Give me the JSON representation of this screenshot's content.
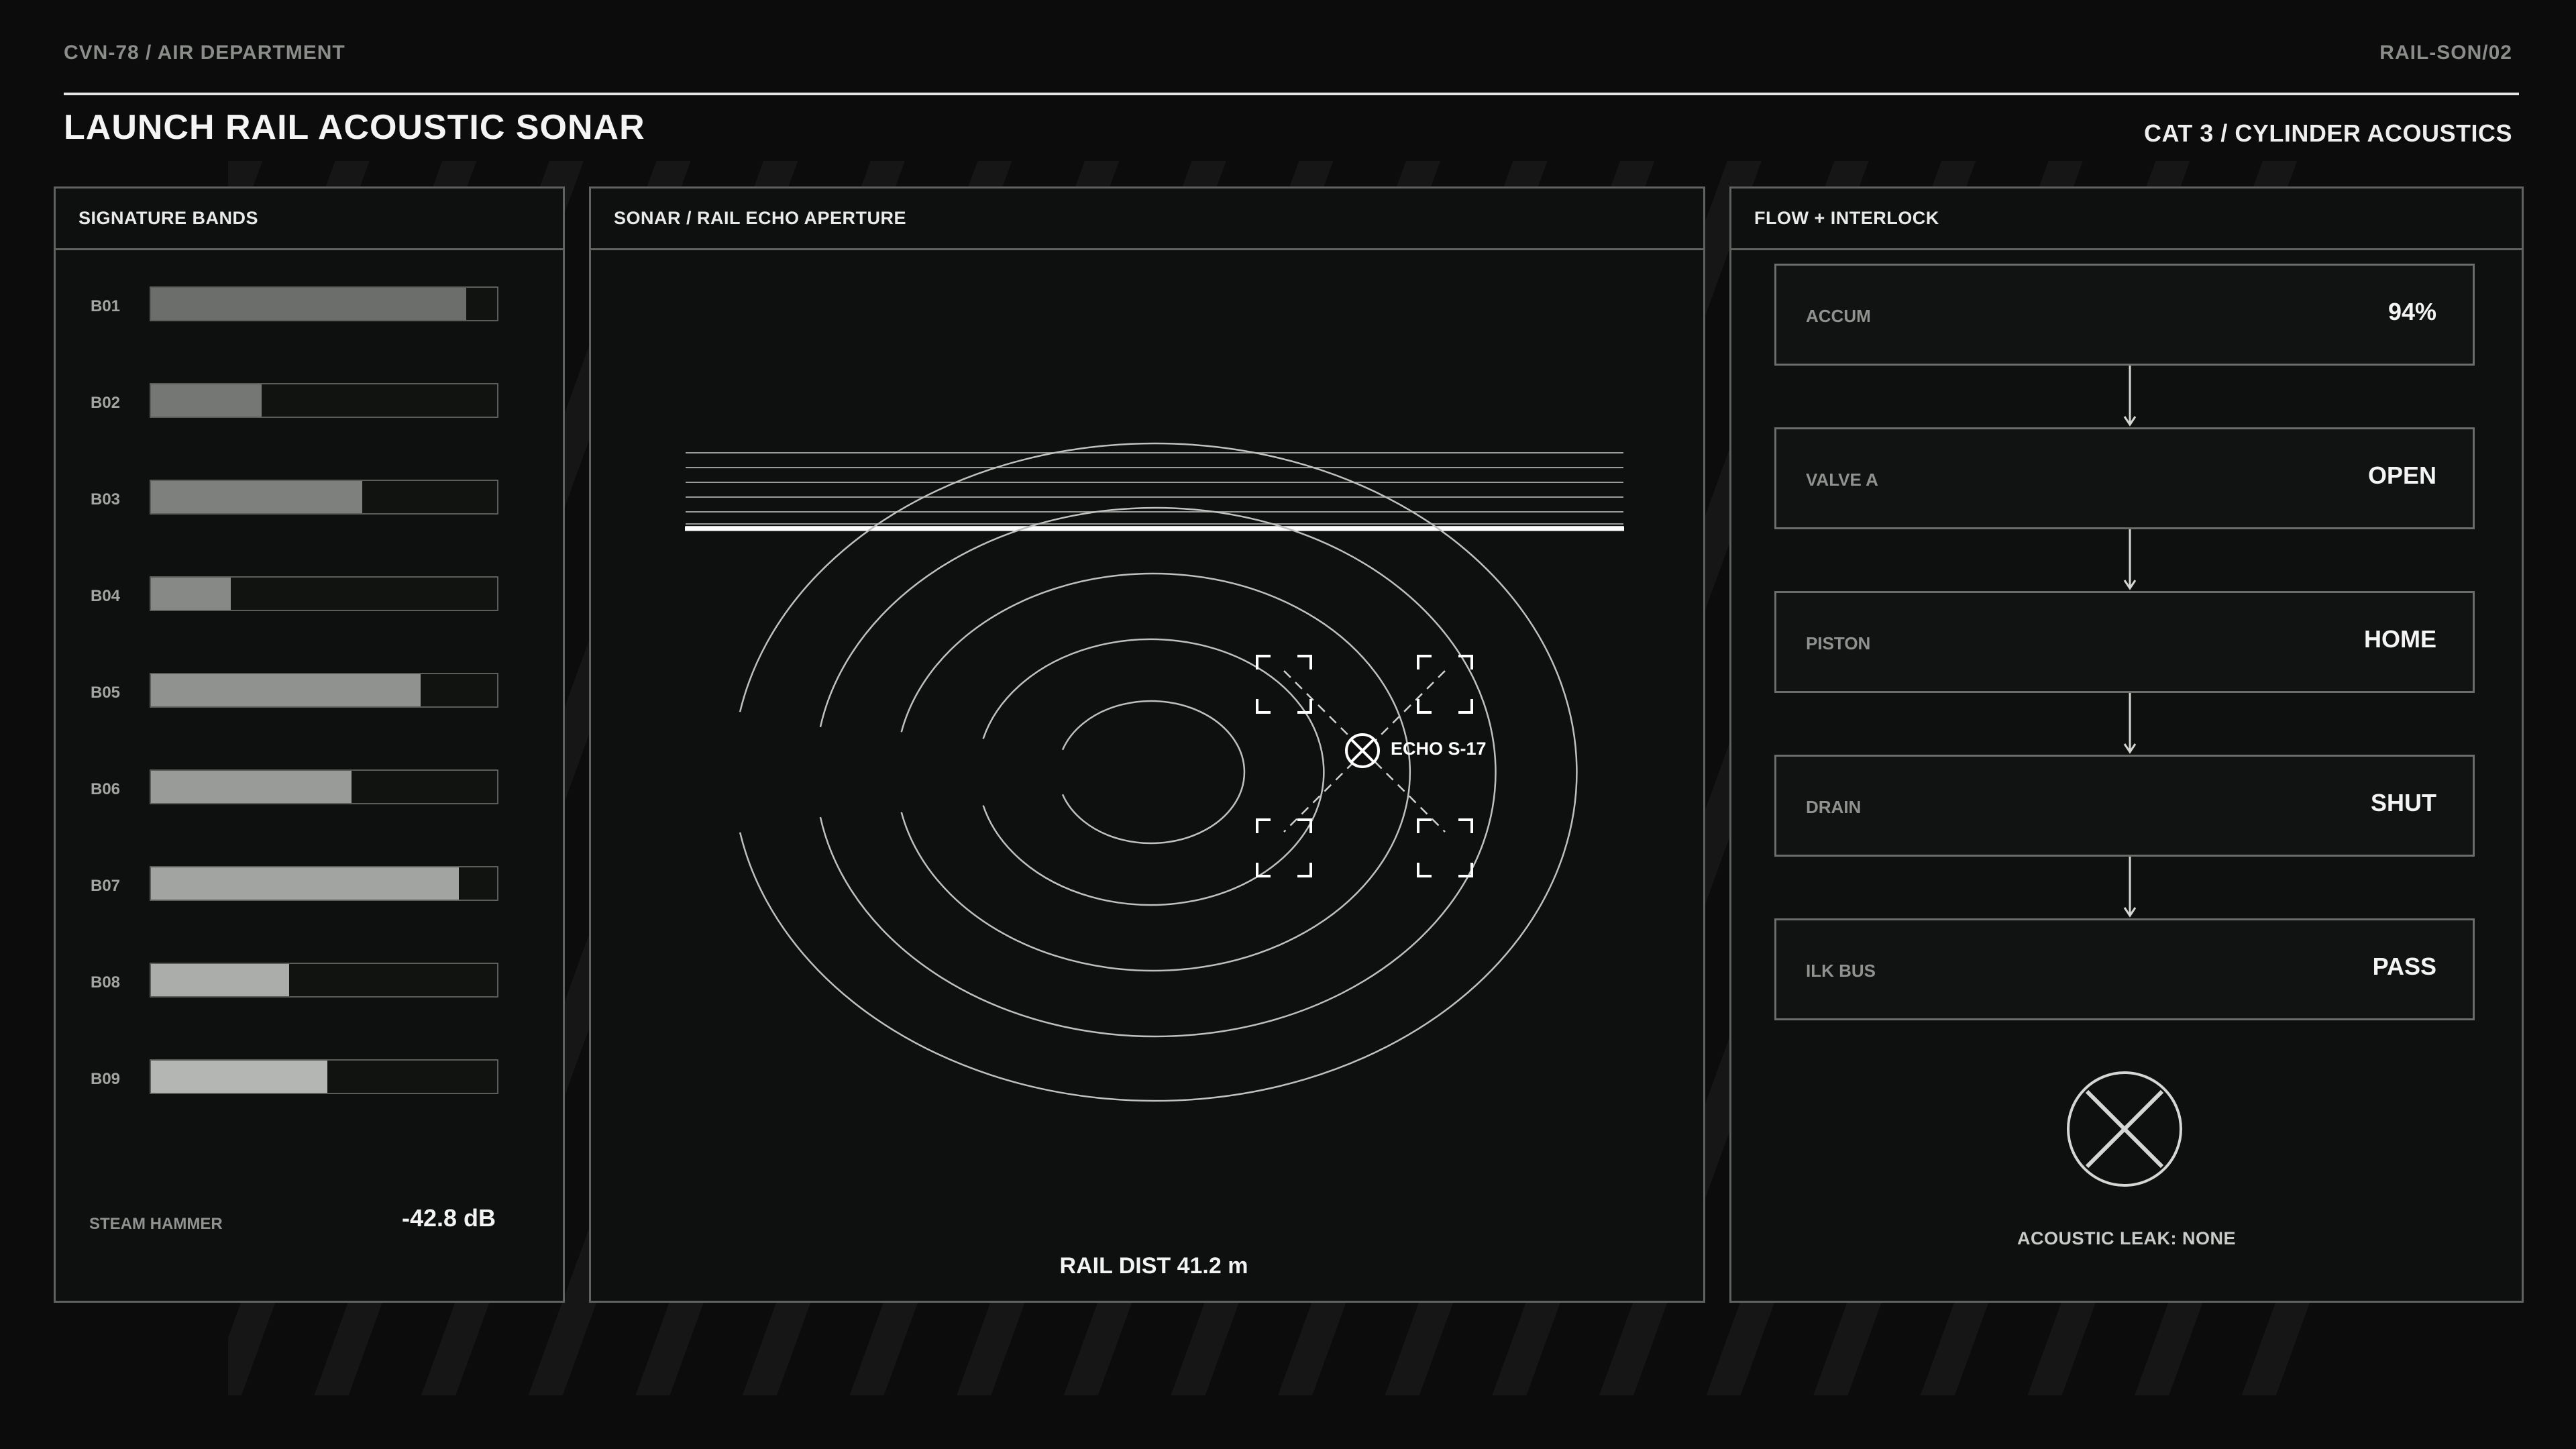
{
  "header": {
    "breadcrumb": "CVN-78 / AIR DEPARTMENT",
    "code": "RAIL-SON/02",
    "title": "LAUNCH RAIL ACOUSTIC SONAR",
    "subtitle": "CAT 3 / CYLINDER ACOUSTICS"
  },
  "signature_bands": {
    "title": "SIGNATURE BANDS",
    "bands": [
      {
        "label": "B01",
        "level": 0.91
      },
      {
        "label": "B02",
        "level": 0.32
      },
      {
        "label": "B03",
        "level": 0.61
      },
      {
        "label": "B04",
        "level": 0.23
      },
      {
        "label": "B05",
        "level": 0.78
      },
      {
        "label": "B06",
        "level": 0.58
      },
      {
        "label": "B07",
        "level": 0.89
      },
      {
        "label": "B08",
        "level": 0.4
      },
      {
        "label": "B09",
        "level": 0.51
      }
    ],
    "hammer_label": "STEAM HAMMER",
    "hammer_value": "-42.8 dB"
  },
  "sonar": {
    "title": "SONAR / RAIL ECHO APERTURE",
    "echo_label": "ECHO S-17",
    "rail_dist": "RAIL DIST 41.2 m"
  },
  "flow": {
    "title": "FLOW + INTERLOCK",
    "items": [
      {
        "label": "ACCUM",
        "value": "94%"
      },
      {
        "label": "VALVE A",
        "value": "OPEN"
      },
      {
        "label": "PISTON",
        "value": "HOME"
      },
      {
        "label": "DRAIN",
        "value": "SHUT"
      },
      {
        "label": "ILK BUS",
        "value": "PASS"
      }
    ],
    "leak_status": "ACOUSTIC LEAK: NONE"
  },
  "colors": {
    "background": "#0b0c0b",
    "panel_border": "#5f625f",
    "band_fill_dark": "#6b6e6b",
    "band_fill_light": "#b3b6b3",
    "accent": "#ffffff"
  }
}
